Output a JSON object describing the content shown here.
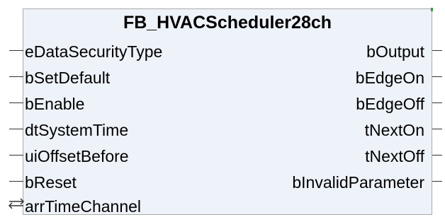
{
  "block": {
    "title": "FB_HVACScheduler28ch",
    "inputs": [
      "eDataSecurityType",
      "bSetDefault",
      "bEnable",
      "dtSystemTime",
      "uiOffsetBefore",
      "bReset"
    ],
    "outputs": [
      "bOutput",
      "bEdgeOn",
      "bEdgeOff",
      "tNextOn",
      "tNextOff",
      "bInvalidParameter"
    ],
    "inout": "arrTimeChannel",
    "colors": {
      "background": "#eef2f9",
      "border": "#a9a9a9",
      "pin": "#333333",
      "corner_mark": "#3c9a3c"
    }
  }
}
